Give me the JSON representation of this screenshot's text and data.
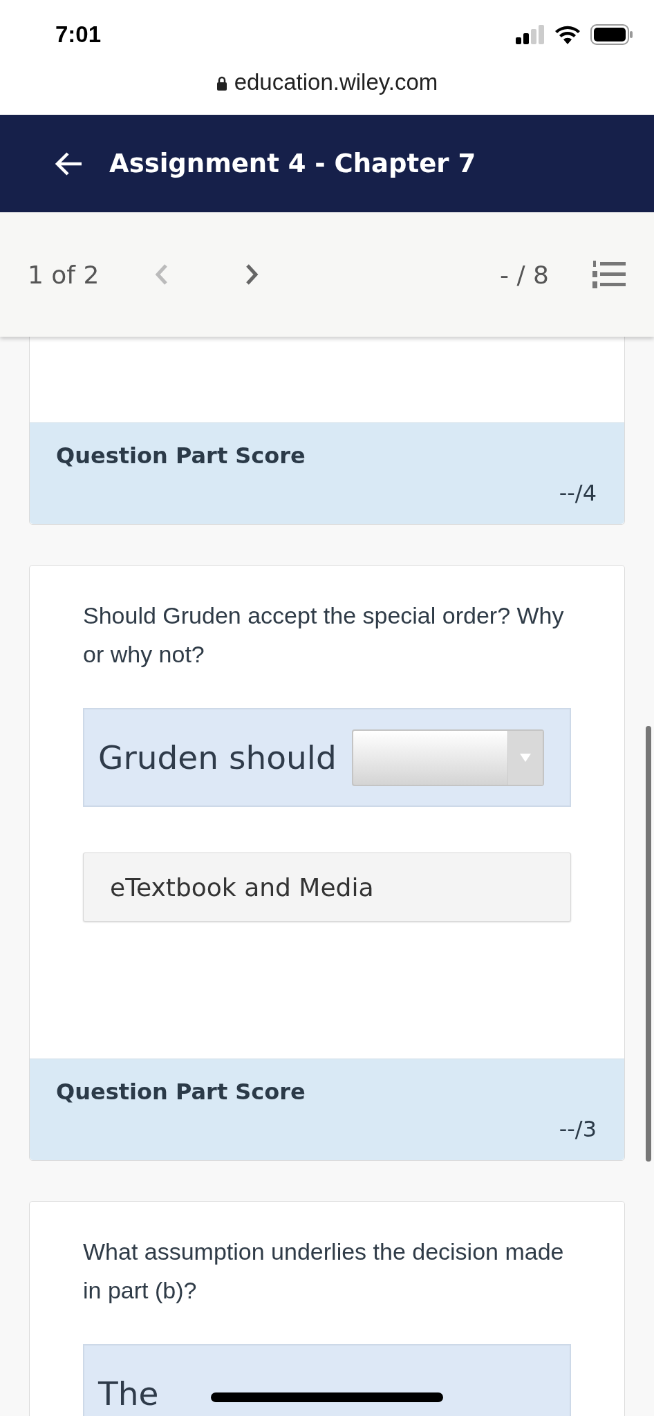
{
  "status_bar": {
    "time": "7:01"
  },
  "browser": {
    "url": "education.wiley.com"
  },
  "header": {
    "title": "Assignment 4 - Chapter 7"
  },
  "toolbar": {
    "position": "1 of 2",
    "prev": {
      "disabled": true
    },
    "next": {
      "disabled": false
    },
    "score": "- / 8"
  },
  "cards": [
    {
      "score": {
        "label": "Question Part Score",
        "value": "--/4"
      }
    },
    {
      "question": "Should Gruden accept the special order? Why or why not?",
      "answer": {
        "prefix": "Gruden should",
        "dropdown": true
      },
      "resource_button": "eTextbook and Media",
      "score": {
        "label": "Question Part Score",
        "value": "--/3"
      }
    },
    {
      "question": "What assumption underlies the decision made in part (b)?",
      "answer": {
        "prefix": "The"
      }
    }
  ]
}
